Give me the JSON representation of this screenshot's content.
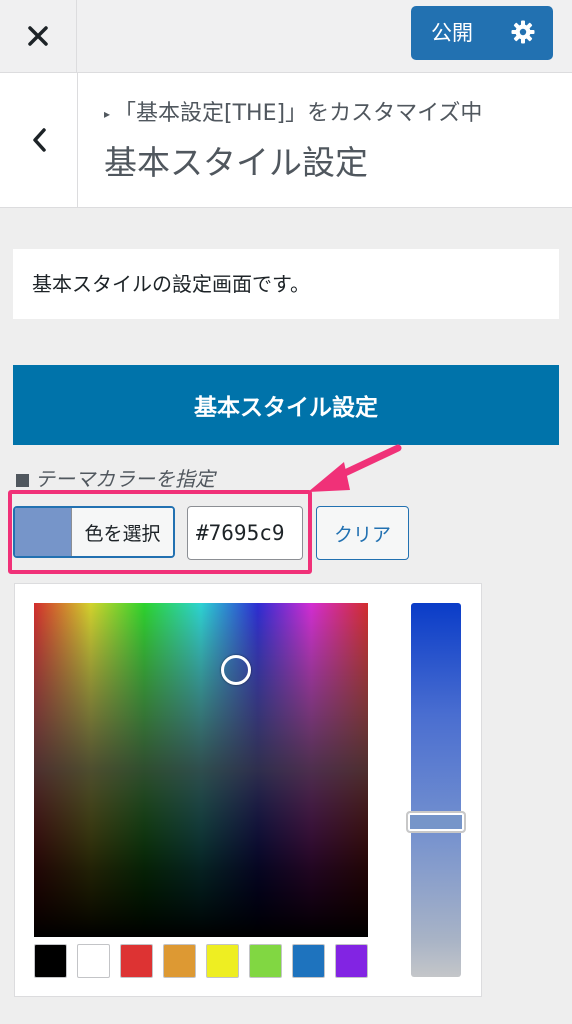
{
  "topbar": {
    "close_icon": "close-icon",
    "publish_label": "公開",
    "settings_icon": "gear-icon"
  },
  "header": {
    "back_icon": "chevron-left-icon",
    "breadcrumb": "「基本設定[THE]」をカスタマイズ中",
    "title": "基本スタイル設定"
  },
  "description": "基本スタイルの設定画面です。",
  "section_heading": "基本スタイル設定",
  "control": {
    "label": "テーマカラーを指定",
    "select_color_label": "色を選択",
    "hex_value": "#7695c9",
    "clear_label": "クリア",
    "current_color": "#7695c9"
  },
  "palette": [
    "#000000",
    "#ffffff",
    "#dd3333",
    "#dd9933",
    "#eeee22",
    "#81d742",
    "#1e73be",
    "#8224e3"
  ],
  "annotation_color": "#f03178",
  "accent_color": "#2271b1"
}
